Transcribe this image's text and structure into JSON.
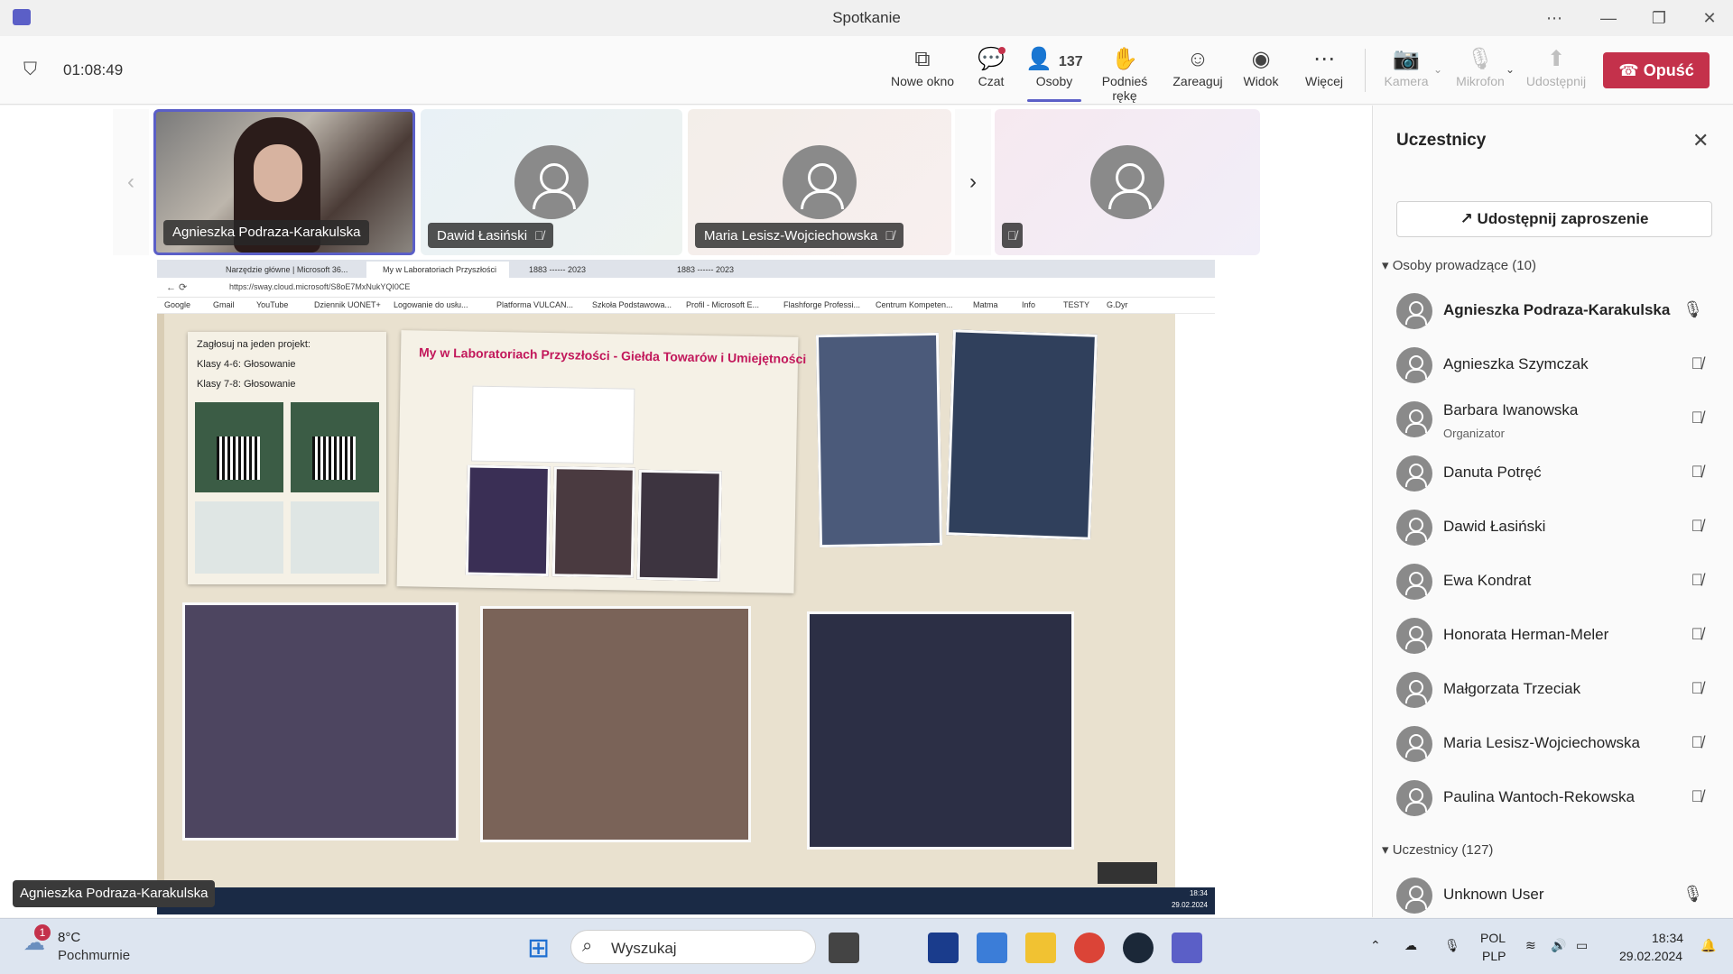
{
  "window": {
    "title": "Spotkanie",
    "controls": [
      "⋯",
      "—",
      "❐",
      "✕"
    ]
  },
  "meeting": {
    "timer": "01:08:49",
    "toolbar": [
      {
        "label": "Nowe okno",
        "icon": "new-window-icon",
        "glyph": "⧉"
      },
      {
        "label": "Czat",
        "icon": "chat-icon",
        "glyph": "💬"
      },
      {
        "label": "Osoby",
        "icon": "people-icon",
        "glyph": "👤",
        "count": "137"
      },
      {
        "label": "Podnieś rękę",
        "icon": "raise-hand-icon",
        "glyph": "✋"
      },
      {
        "label": "Zareaguj",
        "icon": "react-icon",
        "glyph": "☺"
      },
      {
        "label": "Widok",
        "icon": "view-icon",
        "glyph": "◉"
      },
      {
        "label": "Więcej",
        "icon": "more-icon",
        "glyph": "⋯"
      }
    ],
    "devices": [
      {
        "label": "Kamera",
        "icon": "camera-off-icon",
        "glyph": "📷"
      },
      {
        "label": "Mikrofon",
        "icon": "mic-off-icon",
        "glyph": "🎙"
      },
      {
        "label": "Udostępnij",
        "icon": "share-icon",
        "glyph": "⬆"
      }
    ],
    "leave_label": "Opuść"
  },
  "video_tiles": [
    {
      "name": "Agnieszka Podraza-Karakulska",
      "video": true
    },
    {
      "name": "Dawid Łasiński",
      "video": false
    },
    {
      "name": "Maria Lesisz-Wojciechowska",
      "video": false
    },
    {
      "name": "",
      "video": false
    }
  ],
  "presenter_chip": "Agnieszka Podraza-Karakulska",
  "shared_screen": {
    "tabs": [
      "Narzędzie główne | Microsoft 36...",
      "My w Laboratoriach Przyszłości",
      "1883 ------ 2023",
      "1883 ------ 2023"
    ],
    "url": "https://sway.cloud.microsoft/S8oE7MxNukYQI0CE",
    "bookmarks": [
      "Google",
      "Gmail",
      "YouTube",
      "Dziennik UONET+",
      "Logowanie do usłu...",
      "Platforma VULCAN...",
      "Szkoła Podstawowa...",
      "Profil - Microsoft E...",
      "Flashforge Professi...",
      "Centrum Kompeten...",
      "Matma",
      "Info",
      "TESTY",
      "G.Dyr"
    ],
    "poll_title": "Zagłosuj na jeden projekt:",
    "poll_items": [
      "Klasy 4-6: Głosowanie",
      "Klasy 7-8: Głosowanie"
    ],
    "banner": "My w Laboratoriach Przyszłości  - Giełda Towarów i Umiejętności",
    "remote_clock": "18:34",
    "remote_date": "29.02.2024"
  },
  "participants_panel": {
    "title": "Uczestnicy",
    "invite_label": "Udostępnij zaproszenie",
    "organizers_header": "Osoby prowadzące (10)",
    "organizers": [
      {
        "name": "Agnieszka Podraza-Karakulska",
        "role": "",
        "mic": "on"
      },
      {
        "name": "Agnieszka Szymczak",
        "role": "",
        "mic": "off"
      },
      {
        "name": "Barbara Iwanowska",
        "role": "Organizator",
        "mic": "off"
      },
      {
        "name": "Danuta Potręć",
        "role": "",
        "mic": "off"
      },
      {
        "name": "Dawid Łasiński",
        "role": "",
        "mic": "off"
      },
      {
        "name": "Ewa Kondrat",
        "role": "",
        "mic": "off"
      },
      {
        "name": "Honorata Herman-Meler",
        "role": "",
        "mic": "off"
      },
      {
        "name": "Małgorzata Trzeciak",
        "role": "",
        "mic": "off"
      },
      {
        "name": "Maria Lesisz-Wojciechowska",
        "role": "",
        "mic": "off"
      },
      {
        "name": "Paulina Wantoch-Rekowska",
        "role": "",
        "mic": "off"
      }
    ],
    "attendees_header": "Uczestnicy (127)",
    "attendees": [
      {
        "name": "Unknown User",
        "role": "",
        "mic": "on"
      }
    ]
  },
  "taskbar": {
    "weather_temp": "8°C",
    "weather_desc": "Pochmurnie",
    "weather_badge": "1",
    "search_placeholder": "Wyszukaj",
    "lang_top": "POL",
    "lang_bottom": "PLP",
    "time": "18:34",
    "date": "29.02.2024"
  },
  "colors": {
    "accent": "#5b5fc7",
    "leave": "#c4314b",
    "panel": "#fafafa"
  }
}
